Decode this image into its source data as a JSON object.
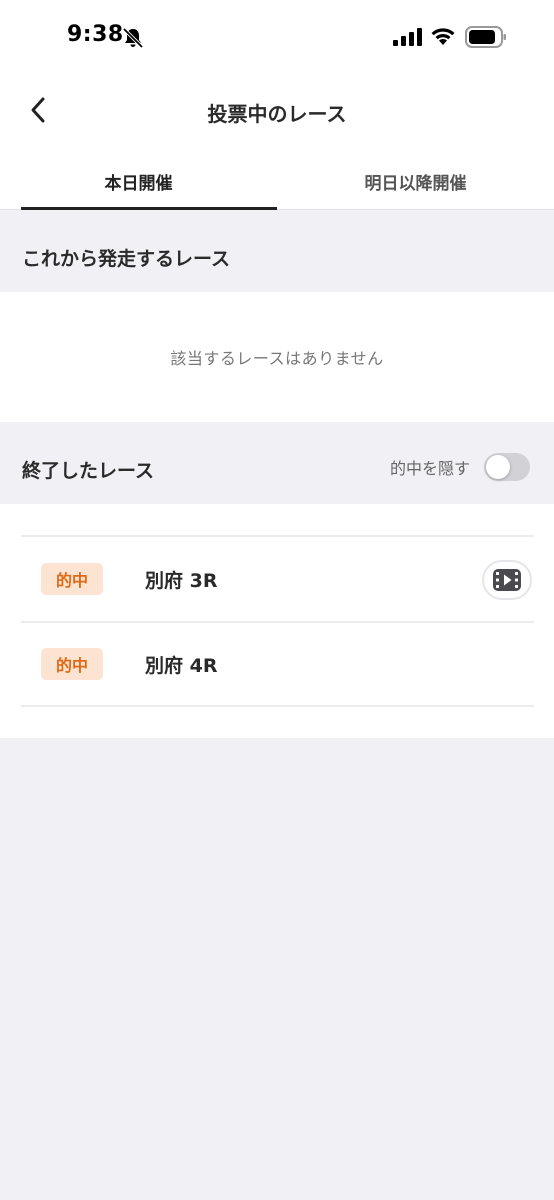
{
  "status_bar": {
    "time": "9:38",
    "icons": [
      "bell-slash-icon",
      "signal-icon",
      "wifi-icon",
      "battery-icon"
    ]
  },
  "nav": {
    "title": "投票中のレース",
    "back_icon": "chevron-left-icon"
  },
  "tabs": [
    {
      "label": "本日開催",
      "active": true
    },
    {
      "label": "明日以降開催",
      "active": false
    }
  ],
  "upcoming": {
    "title": "これから発走するレース",
    "empty_text": "該当するレースはありません"
  },
  "finished": {
    "title": "終了したレース",
    "hide_hits_label": "的中を隠す",
    "hide_hits_on": false,
    "races": [
      {
        "badge": "的中",
        "name": "別府 3R",
        "has_video": true
      },
      {
        "badge": "的中",
        "name": "別府 4R",
        "has_video": false
      }
    ]
  },
  "colors": {
    "background": "#f0f0f5",
    "badge_bg": "#fde3d2",
    "badge_text": "#e06a15",
    "active_tab_underline": "#222222"
  }
}
